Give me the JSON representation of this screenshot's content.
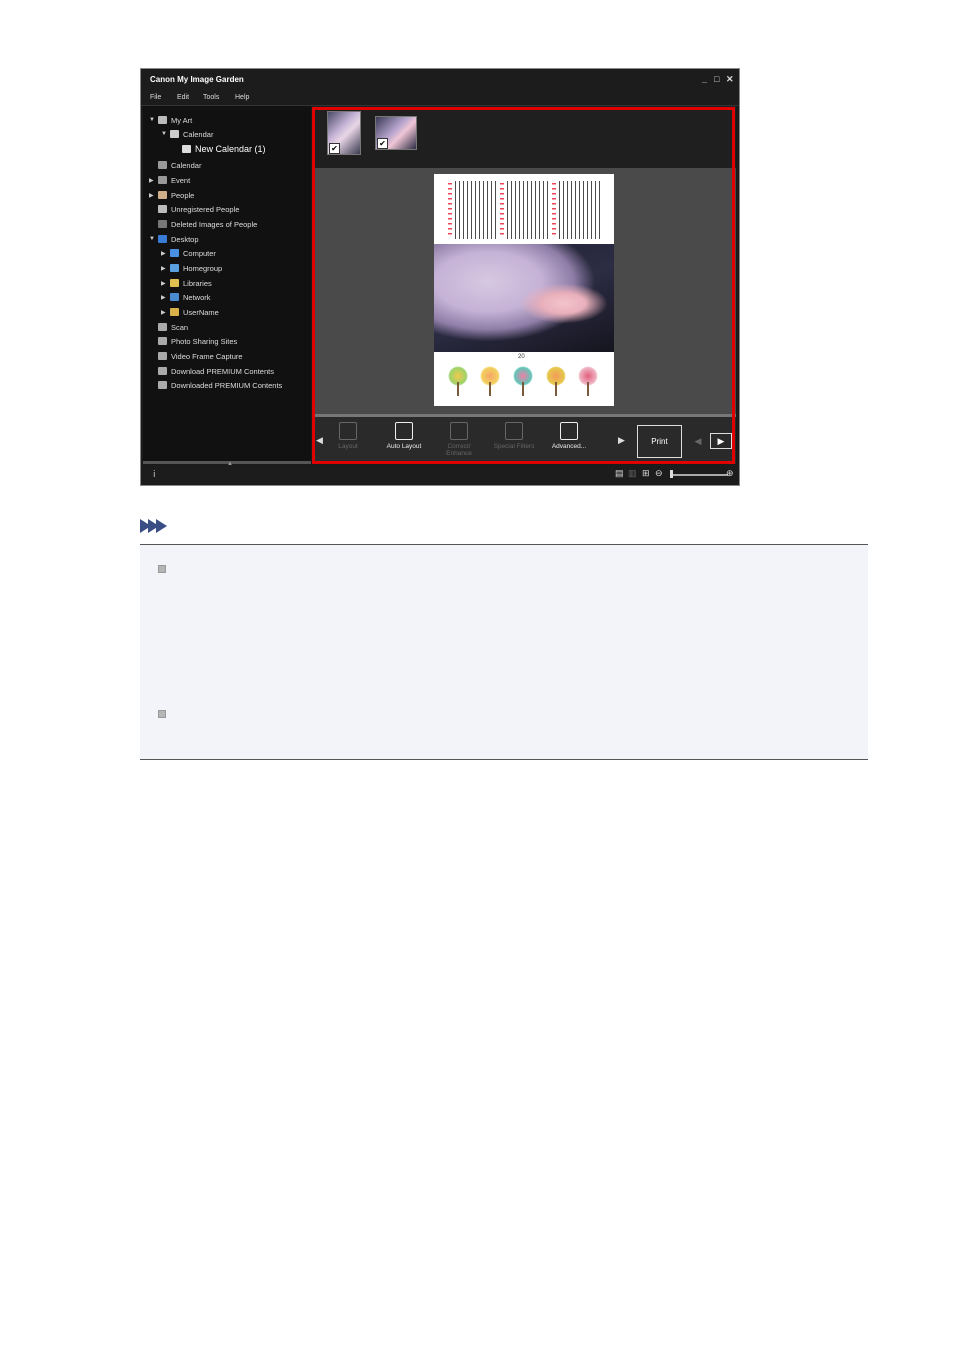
{
  "window": {
    "title": "Canon My Image Garden",
    "controls": [
      "_",
      "□",
      "✕"
    ]
  },
  "menu": [
    "File",
    "Edit",
    "Tools",
    "Help"
  ],
  "sidebar": {
    "items": [
      {
        "label": "My Art",
        "level": 0,
        "arrow": "▼",
        "icon": "my-art-icon",
        "color": "#bbbbbb"
      },
      {
        "label": "Calendar",
        "level": 1,
        "arrow": "▼",
        "icon": "calendar-icon",
        "color": "#cccccc"
      },
      {
        "label": "New Calendar (1)",
        "level": 2,
        "arrow": "",
        "icon": "calendar-item-icon",
        "color": "#dddddd",
        "selected": true
      },
      {
        "label": "Calendar",
        "level": 0,
        "arrow": "",
        "icon": "calendar-view-icon",
        "color": "#999999"
      },
      {
        "label": "Event",
        "level": 0,
        "arrow": "▶",
        "icon": "event-icon",
        "color": "#999999"
      },
      {
        "label": "People",
        "level": 0,
        "arrow": "▶",
        "icon": "people-icon",
        "color": "#cfae8a"
      },
      {
        "label": "Unregistered People",
        "level": 0,
        "arrow": "",
        "icon": "unregistered-people-icon",
        "color": "#bbbbbb"
      },
      {
        "label": "Deleted Images of People",
        "level": 0,
        "arrow": "",
        "icon": "deleted-people-icon",
        "color": "#777777"
      },
      {
        "label": "Desktop",
        "level": 0,
        "arrow": "▼",
        "icon": "desktop-icon",
        "color": "#3a7bd5"
      },
      {
        "label": "Computer",
        "level": 1,
        "arrow": "▶",
        "icon": "computer-icon",
        "color": "#4a90e2"
      },
      {
        "label": "Homegroup",
        "level": 1,
        "arrow": "▶",
        "icon": "homegroup-icon",
        "color": "#5aa0e0"
      },
      {
        "label": "Libraries",
        "level": 1,
        "arrow": "▶",
        "icon": "libraries-icon",
        "color": "#e0c050"
      },
      {
        "label": "Network",
        "level": 1,
        "arrow": "▶",
        "icon": "network-icon",
        "color": "#4a8ad0"
      },
      {
        "label": "UserName",
        "level": 1,
        "arrow": "▶",
        "icon": "user-folder-icon",
        "color": "#d9b24a"
      },
      {
        "label": "Scan",
        "level": 0,
        "arrow": "",
        "icon": "scan-icon",
        "color": "#aaaaaa"
      },
      {
        "label": "Photo Sharing Sites",
        "level": 0,
        "arrow": "",
        "icon": "photo-sharing-icon",
        "color": "#aaaaaa"
      },
      {
        "label": "Video Frame Capture",
        "level": 0,
        "arrow": "",
        "icon": "video-frame-icon",
        "color": "#aaaaaa"
      },
      {
        "label": "Download PREMIUM Contents",
        "level": 0,
        "arrow": "",
        "icon": "download-premium-icon",
        "color": "#aaaaaa"
      },
      {
        "label": "Downloaded PREMIUM Contents",
        "level": 0,
        "arrow": "",
        "icon": "downloaded-premium-icon",
        "color": "#aaaaaa"
      }
    ]
  },
  "calendar_page": {
    "year": "20"
  },
  "toolbar": {
    "tools": [
      {
        "label": "Layout",
        "enabled": false,
        "icon": "layout-icon"
      },
      {
        "label": "Auto Layout",
        "enabled": true,
        "icon": "auto-layout-icon"
      },
      {
        "label": "Correct/ Enhance",
        "enabled": false,
        "icon": "correct-enhance-icon"
      },
      {
        "label": "Special Filters",
        "enabled": false,
        "icon": "special-filters-icon"
      },
      {
        "label": "Advanced...",
        "enabled": true,
        "icon": "advanced-icon"
      }
    ],
    "print_label": "Print"
  },
  "colors": {
    "highlight": "#e10000",
    "note_icon": "#3b4d85",
    "note_bg": "#f2f4f9"
  }
}
